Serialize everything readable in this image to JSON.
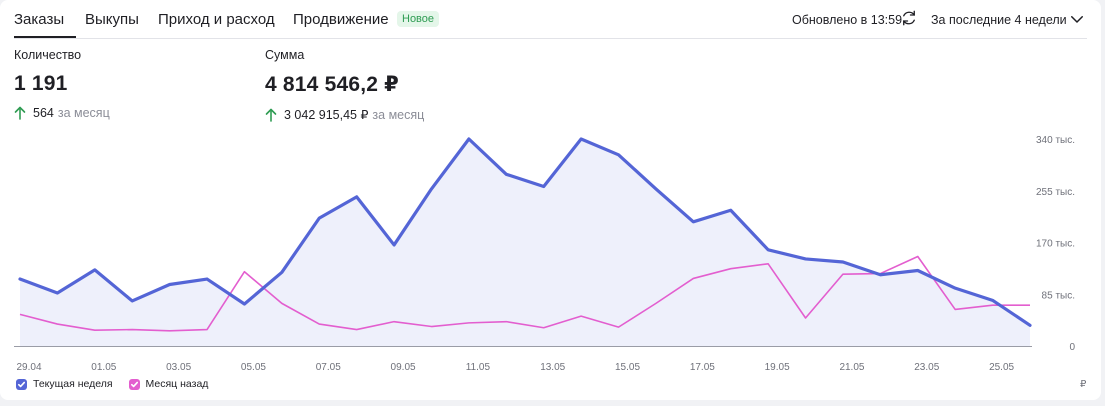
{
  "tabs": [
    {
      "label": "Заказы",
      "active": true
    },
    {
      "label": "Выкупы",
      "active": false
    },
    {
      "label": "Приход и расход",
      "active": false
    },
    {
      "label": "Продвижение",
      "active": false
    }
  ],
  "badge_new": "Новое",
  "updated_text": "Обновлено в 13:59",
  "period_label": "За последние 4 недели",
  "metrics": {
    "quantity": {
      "label": "Количество",
      "value": "1 191",
      "delta": "564",
      "delta_suffix": "за месяц"
    },
    "sum": {
      "label": "Сумма",
      "value": "4 814 546,2 ₽",
      "delta": "3 042 915,45 ₽",
      "delta_suffix": "за месяц"
    }
  },
  "colors": {
    "current": "#5465d6",
    "previous": "#e35ecf",
    "fill": "#eef0fb",
    "up_arrow": "#2f9c53"
  },
  "chart_data": {
    "type": "line",
    "x": [
      "29.04",
      "30.04",
      "01.05",
      "02.05",
      "03.05",
      "04.05",
      "05.05",
      "06.05",
      "07.05",
      "08.05",
      "09.05",
      "10.05",
      "11.05",
      "12.05",
      "13.05",
      "14.05",
      "15.05",
      "16.05",
      "17.05",
      "18.05",
      "19.05",
      "20.05",
      "21.05",
      "22.05",
      "23.05",
      "24.05",
      "25.05",
      "26.05"
    ],
    "x_tick_labels": [
      "29.04",
      "01.05",
      "03.05",
      "05.05",
      "07.05",
      "09.05",
      "11.05",
      "13.05",
      "15.05",
      "17.05",
      "19.05",
      "21.05",
      "23.05",
      "25.05"
    ],
    "y_tick_labels": [
      "340 тыс.",
      "255 тыс.",
      "170 тыс.",
      "85 тыс.",
      "0"
    ],
    "y_ticks": [
      340000,
      255000,
      170000,
      85000,
      0
    ],
    "ylim": [
      0,
      340000
    ],
    "series": [
      {
        "name": "Текущая неделя",
        "values": [
          110000,
          87000,
          125000,
          74000,
          101000,
          110000,
          69000,
          121000,
          210000,
          245000,
          166000,
          258000,
          340000,
          282000,
          262000,
          340000,
          314000,
          258000,
          204000,
          223000,
          158000,
          143000,
          138000,
          117000,
          124000,
          95000,
          75000,
          34000
        ]
      },
      {
        "name": "Месяц назад",
        "values": [
          52000,
          36000,
          26000,
          27000,
          25000,
          27000,
          122000,
          70000,
          36000,
          27000,
          40000,
          32000,
          38000,
          40000,
          30000,
          49000,
          31000,
          70000,
          111000,
          127000,
          135000,
          46000,
          118000,
          119000,
          147000,
          60000,
          67000,
          67000
        ]
      }
    ],
    "legend_position": "bottom-left",
    "currency": "₽"
  }
}
